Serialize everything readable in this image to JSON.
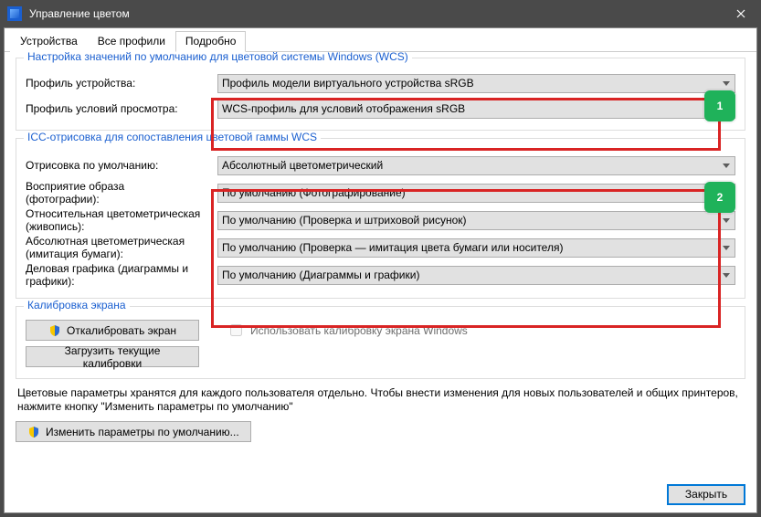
{
  "window": {
    "title": "Управление цветом",
    "close_label": "Закрыть"
  },
  "tabs": {
    "devices": "Устройства",
    "all_profiles": "Все профили",
    "details": "Подробно"
  },
  "group_wcs": {
    "legend": "Настройка значений по умолчанию для цветовой системы Windows (WCS)",
    "device_profile_label": "Профиль устройства:",
    "device_profile_value": "Профиль модели виртуального устройства sRGB",
    "viewing_profile_label": "Профиль условий просмотра:",
    "viewing_profile_value": "WCS-профиль для условий отображения sRGB"
  },
  "group_icc": {
    "legend": "ICC-отрисовка для сопоставления цветовой гаммы WCS",
    "default_intent_label": "Отрисовка по умолчанию:",
    "default_intent_value": "Абсолютный цветометрический",
    "perceptual_label_l1": "Восприятие образа",
    "perceptual_label_l2": "(фотографии):",
    "perceptual_value": "По умолчанию (Фотографирование)",
    "relcol_label_l1": "Относительная цветометрическая",
    "relcol_label_l2": "(живопись):",
    "relcol_value": "По умолчанию (Проверка и штриховой рисунок)",
    "abscol_label_l1": "Абсолютная цветометрическая",
    "abscol_label_l2": "(имитация бумаги):",
    "abscol_value": "По умолчанию (Проверка — имитация цвета бумаги или носителя)",
    "business_label_l1": "Деловая графика (диаграммы и",
    "business_label_l2": "графики):",
    "business_value": "По умолчанию (Диаграммы и графики)"
  },
  "group_cal": {
    "legend": "Калибровка экрана",
    "calibrate_btn": "Откалибровать экран",
    "use_windows_cal": "Использовать калибровку экрана Windows",
    "load_cal_btn": "Загрузить текущие калибровки"
  },
  "footer": {
    "note": "Цветовые параметры хранятся для каждого пользователя отдельно. Чтобы внести изменения для новых пользователей и общих принтеров, нажмите кнопку \"Изменить параметры по умолчанию\"",
    "change_defaults_btn": "Изменить параметры по умолчанию..."
  },
  "annotations": {
    "badge1": "1",
    "badge2": "2"
  }
}
